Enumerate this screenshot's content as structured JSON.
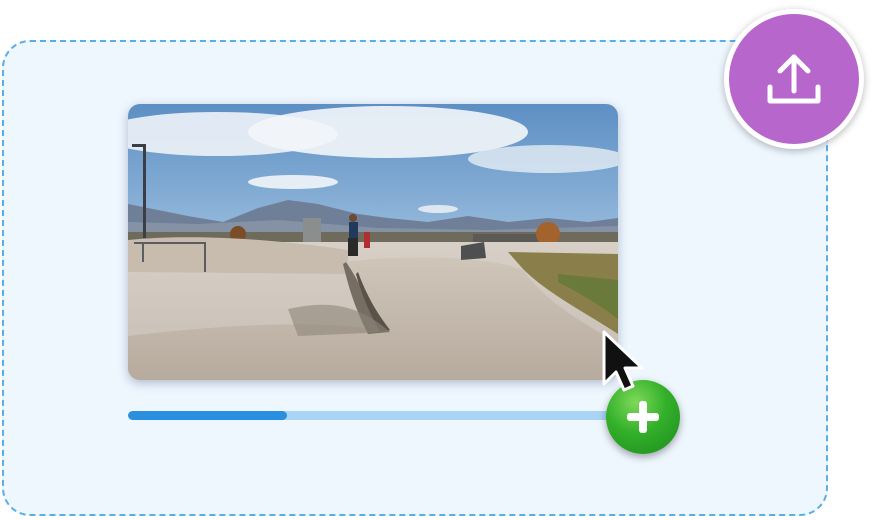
{
  "dropzone": {
    "border_color": "#5aaee8",
    "background_color": "#eef6fe"
  },
  "upload_button": {
    "icon": "upload-icon",
    "color": "#b766cc"
  },
  "thumbnail": {
    "content": "skatepark-image"
  },
  "upload_progress": {
    "value": 0.31,
    "fill_color": "#2b8fe0",
    "track_color": "#a9d4f6"
  },
  "cursor": {
    "icon": "arrow-cursor-icon"
  },
  "add_badge": {
    "icon": "plus-icon",
    "color": "#33b02a"
  }
}
